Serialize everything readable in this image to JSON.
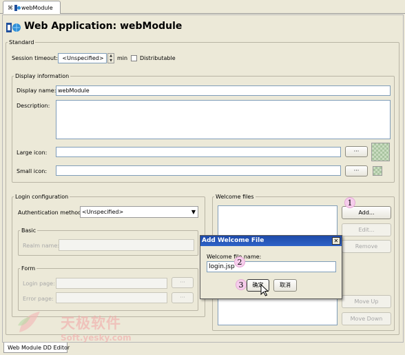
{
  "editor_tab": {
    "label": "webModule",
    "pin_glyph": "⌘"
  },
  "page_title": "Web Application: webModule",
  "standard": {
    "legend": "Standard",
    "session_timeout_label": "Session timeout:",
    "session_timeout_value": "<Unspecified>",
    "min_label": "min",
    "distributable_label": "Distributable",
    "distributable_checked": false
  },
  "display_info": {
    "legend": "Display information",
    "display_name_label": "Display name:",
    "display_name_value": "webModule",
    "description_label": "Description:",
    "description_value": "",
    "large_icon_label": "Large icon:",
    "large_icon_value": "",
    "small_icon_label": "Small icon:",
    "small_icon_value": "",
    "browse_label": "···"
  },
  "login_config": {
    "legend": "Login configuration",
    "auth_method_label": "Authentication method:",
    "auth_method_value": "<Unspecified>",
    "basic_legend": "Basic",
    "realm_name_label": "Realm name:",
    "form_legend": "Form",
    "login_page_label": "Login page:",
    "error_page_label": "Error page:",
    "browse_label": "···"
  },
  "welcome_files": {
    "legend": "Welcome files",
    "buttons": {
      "add": "Add...",
      "edit": "Edit...",
      "remove": "Remove",
      "move_up": "Move Up",
      "move_down": "Move Down"
    }
  },
  "dialog": {
    "title": "Add Welcome File",
    "close_glyph": "✕",
    "field_label": "Welcome file name:",
    "field_value": "login.jsp",
    "ok_label": "确定",
    "cancel_label": "取消"
  },
  "steps": [
    "1",
    "2",
    "3"
  ],
  "status_tab_label": "Web Module DD Editor",
  "watermark": {
    "main": "天极软件",
    "sub": "Soft.yesky.com"
  },
  "colors": {
    "dialog_title_bg": "#2d62c8",
    "step_badge": "#f6cdec",
    "panel_bg": "#ece9d8",
    "field_border": "#7f9db9"
  }
}
